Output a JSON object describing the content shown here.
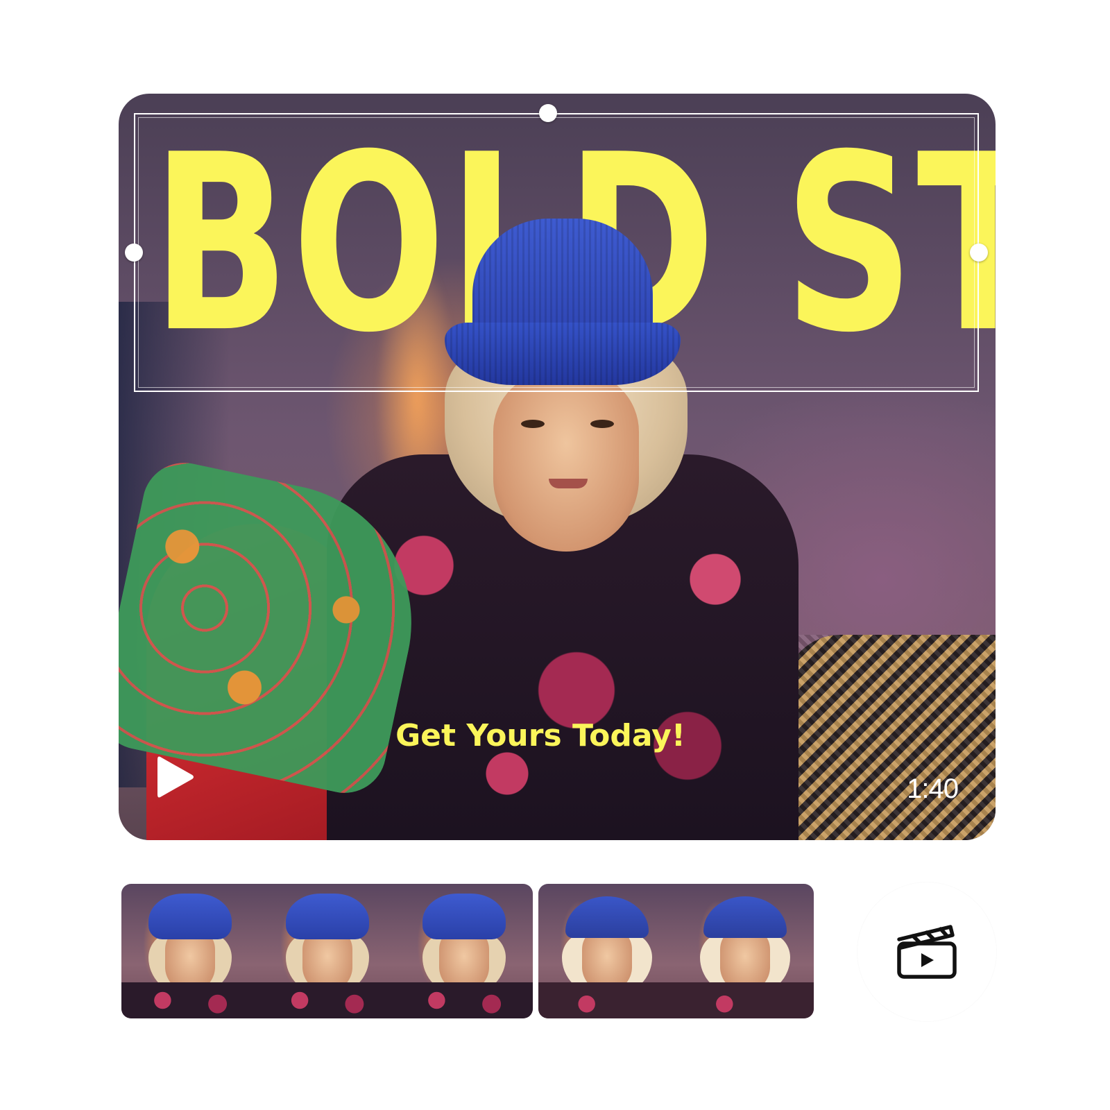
{
  "preview": {
    "title": "BOLD STYLE",
    "caption": "Get Yours Today!",
    "duration": "1:40"
  },
  "icons": {
    "play": "play-icon",
    "video_clip": "video-clip-icon"
  },
  "timeline": {
    "clips": [
      {
        "frames": 3
      },
      {
        "frames": 2
      }
    ]
  },
  "colors": {
    "title": "#fbf55a",
    "caption": "#fbf55a",
    "hat": "#3e5bd0",
    "handle": "#ffffff",
    "duration": "#ffffff"
  }
}
